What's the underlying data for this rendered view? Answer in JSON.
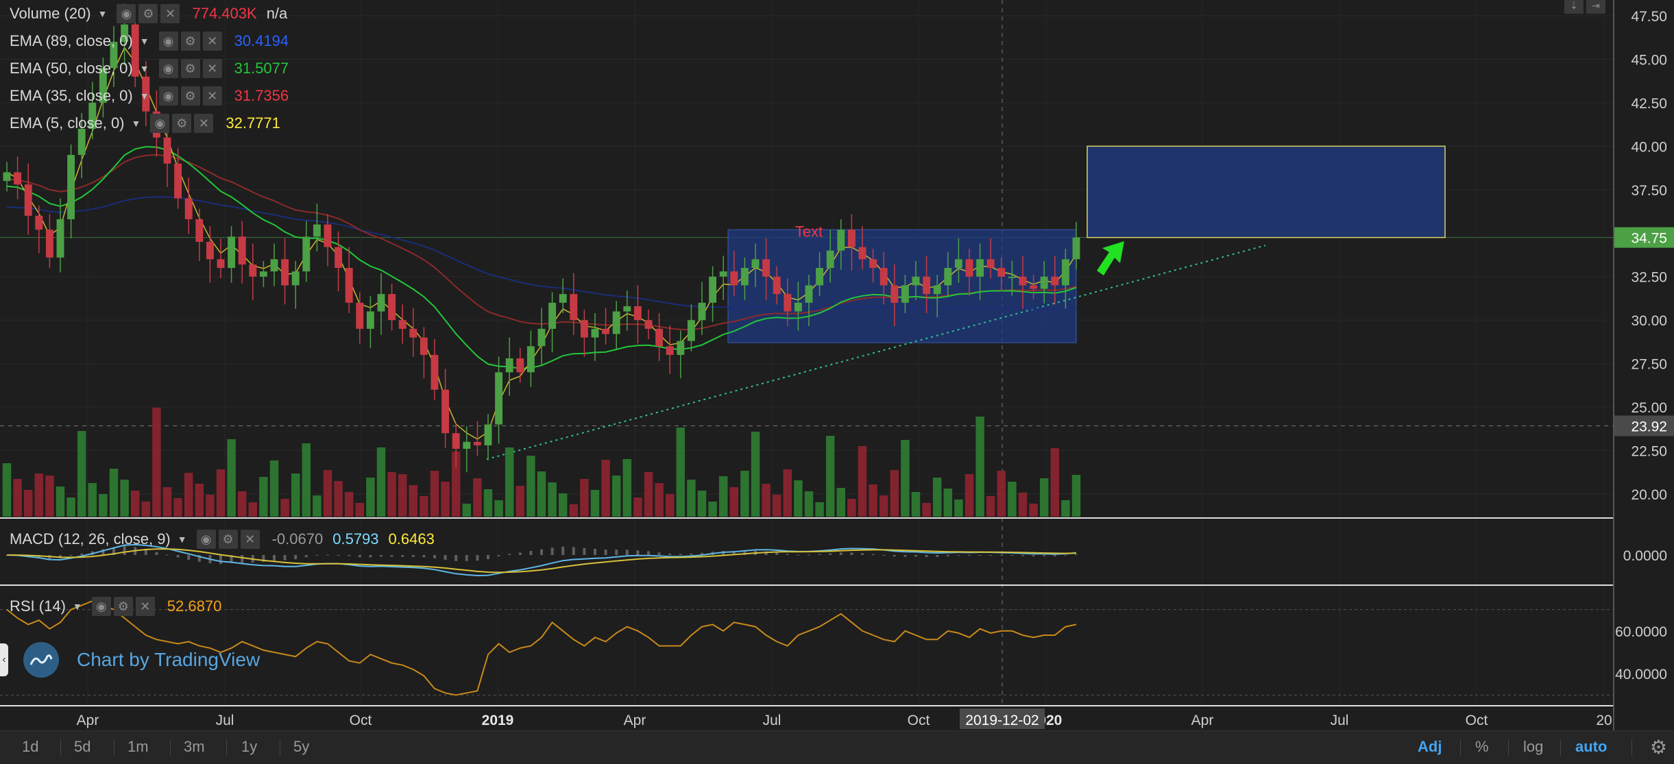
{
  "legend": {
    "volume": {
      "label": "Volume (20)",
      "value": "774.403K",
      "value2": "n/a",
      "color": "#f23645"
    },
    "ema89": {
      "label": "EMA (89, close, 0)",
      "value": "30.4194",
      "color": "#2962ff"
    },
    "ema50": {
      "label": "EMA (50, close, 0)",
      "value": "31.5077",
      "color": "#22ab33"
    },
    "ema35": {
      "label": "EMA (35, close, 0)",
      "value": "31.7356",
      "color": "#f23645"
    },
    "ema5": {
      "label": "EMA (5, close, 0)",
      "value": "32.7771",
      "color": "#ffeb3b"
    },
    "macd": {
      "label": "MACD (12, 26, close, 9)",
      "hist": "-0.0670",
      "macd": "0.5793",
      "signal": "0.6463",
      "hist_color": "#9a9a9a",
      "macd_color": "#7fdcff",
      "signal_color": "#ffeb3b"
    },
    "rsi": {
      "label": "RSI (14)",
      "value": "52.6870",
      "color": "#f7a21b"
    }
  },
  "icons": {
    "eye": "eye-icon",
    "gear": "gear-icon",
    "close": "close-icon"
  },
  "watermark": {
    "text": "Chart by TradingView",
    "icon": "tradingview-logo-icon"
  },
  "toolbar": {
    "timeframes": [
      "1d",
      "5d",
      "1m",
      "3m",
      "1y",
      "5y"
    ],
    "options": {
      "adj": "Adj",
      "pct": "%",
      "log": "log",
      "auto": "auto"
    }
  },
  "annotations": {
    "rect_text": "Text"
  },
  "colors": {
    "up": "#4ca045",
    "down": "#c73a44",
    "grid": "#2b2b2b",
    "accent": "#42a5f5",
    "box_fill": "#1f3a80"
  },
  "chart_data": [
    {
      "type": "candlestick",
      "ylim": [
        17.5,
        48.5
      ],
      "y_ticks": [
        "47.50",
        "45.00",
        "42.50",
        "40.00",
        "37.50",
        "34.75",
        "32.50",
        "30.00",
        "27.50",
        "25.00",
        "23.92",
        "22.50",
        "20.00"
      ],
      "x_ticks": [
        "Apr",
        "Jul",
        "Oct",
        "2019",
        "Apr",
        "Jul",
        "Oct",
        "2020",
        "Apr",
        "Jul",
        "Oct",
        "20"
      ],
      "x_crosshair_label": "2019-12-02",
      "last_price": 34.75,
      "crosshair_price": 23.92,
      "series_close": [
        38.5,
        37.8,
        36.0,
        35.2,
        33.6,
        35.8,
        39.5,
        41.0,
        42.5,
        44.5,
        46.0,
        47.0,
        44.0,
        42.0,
        40.5,
        39.0,
        37.0,
        35.8,
        34.5,
        33.5,
        33.0,
        34.8,
        33.2,
        32.5,
        32.8,
        33.5,
        32.0,
        32.8,
        34.8,
        35.5,
        34.2,
        33.0,
        31.0,
        29.5,
        30.5,
        31.5,
        30.0,
        29.5,
        29.0,
        28.0,
        26.0,
        23.5,
        22.6,
        23.0,
        22.8,
        24.0,
        27.0,
        27.8,
        27.0,
        28.5,
        29.5,
        31.0,
        31.5,
        30.0,
        29.0,
        29.5,
        29.2,
        30.5,
        30.8,
        30.0,
        29.5,
        28.5,
        28.0,
        28.8,
        30.0,
        31.0,
        32.5,
        32.8,
        32.0,
        33.0,
        33.5,
        32.5,
        31.5,
        30.5,
        31.0,
        32.0,
        33.0,
        34.0,
        35.2,
        34.2,
        33.5,
        33.0,
        32.0,
        31.0,
        32.0,
        32.5,
        31.5,
        32.0,
        33.0,
        33.5,
        32.5,
        33.5,
        33.0,
        32.5,
        32.5,
        32.0,
        31.8,
        32.5,
        32.0,
        33.5,
        34.75
      ],
      "ema5_end": 32.7771,
      "ema35_end": 31.7356,
      "ema50_end": 31.5077,
      "ema89_end": 30.4194,
      "volume_last": "774.403K"
    },
    {
      "type": "line",
      "name": "MACD (12, 26, close, 9)",
      "y_ticks": [
        "0.0000"
      ],
      "values": {
        "histogram": -0.067,
        "macd": 0.5793,
        "signal": 0.6463
      }
    },
    {
      "type": "line",
      "name": "RSI (14)",
      "y_ticks": [
        "60.0000",
        "40.0000"
      ],
      "ylim": [
        25,
        75
      ],
      "rsi_series": [
        70,
        66,
        63,
        65,
        61,
        64,
        70,
        72,
        74,
        72,
        70,
        66,
        62,
        58,
        56,
        55,
        54,
        55,
        53,
        52,
        50,
        52,
        55,
        53,
        51,
        50,
        49,
        48,
        52,
        55,
        54,
        50,
        46,
        45,
        49,
        47,
        45,
        44,
        42,
        39,
        33,
        31,
        30,
        31,
        32,
        49,
        54,
        50,
        52,
        53,
        57,
        64,
        60,
        56,
        53,
        57,
        55,
        59,
        62,
        60,
        57,
        53,
        53,
        53,
        58,
        62,
        63,
        60,
        64,
        63,
        62,
        58,
        55,
        53,
        58,
        60,
        62,
        65,
        68,
        64,
        60,
        58,
        56,
        55,
        60,
        58,
        56,
        56,
        60,
        59,
        57,
        61,
        59,
        60,
        60,
        58,
        57,
        58,
        58,
        62,
        63
      ]
    }
  ]
}
